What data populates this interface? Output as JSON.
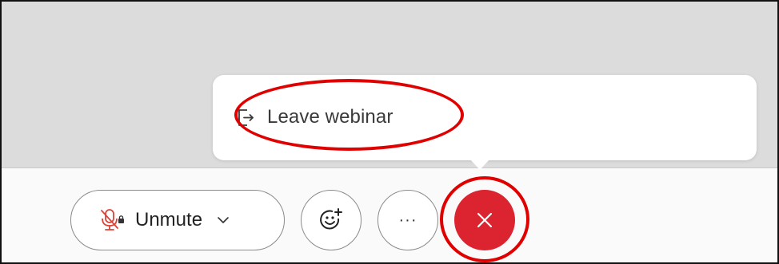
{
  "popover": {
    "items": [
      {
        "label": "Leave webinar",
        "icon": "leave-icon"
      }
    ]
  },
  "controls": {
    "unmute": {
      "label": "Unmute",
      "icon": "muted-microphone-icon",
      "dropdown_icon": "chevron-down-icon",
      "icon_color": "#d9453a"
    },
    "reactions": {
      "icon": "emoji-add-icon"
    },
    "more": {
      "label": "···",
      "icon": "more-options-icon"
    },
    "end": {
      "icon": "close-icon",
      "color": "#dc2430"
    }
  },
  "annotations": {
    "color": "#e00000",
    "highlighted": [
      "Leave webinar menu item",
      "end button"
    ]
  }
}
